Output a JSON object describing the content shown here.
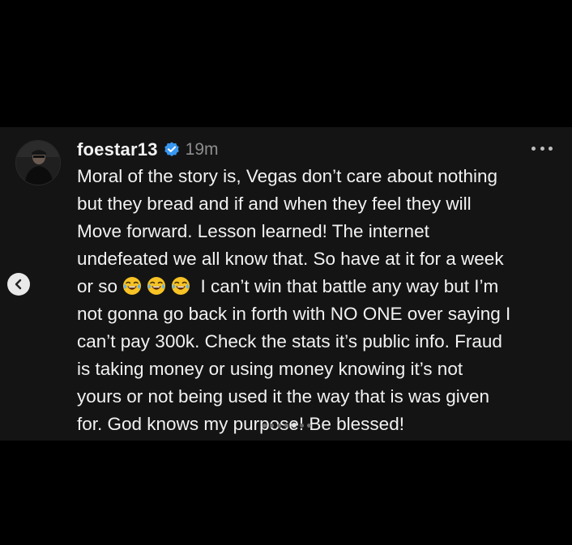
{
  "post": {
    "username": "foestar13",
    "timestamp": "19m",
    "verified": true,
    "lines": [
      "Moral of the story is, Vegas don’t care about nothing",
      "but they bread and if and when they feel they will",
      "Move forward. Lesson learned! The internet",
      "undefeated we all know that. So have at it for a week",
      "or so",
      " I can’t win that battle any way but I’m",
      "not gonna go back in forth with NO ONE over saying I",
      "can’t pay 300k. Check the stats it’s public info. Fraud",
      "is taking money or using money knowing it’s not",
      "yours or not being used it the way that is was given",
      "for. God knows my purpose! Be blessed!"
    ]
  },
  "icons": {
    "avatar": "profile-photo",
    "verified": "verified-badge-icon",
    "more": "more-options-icon",
    "emoji": "face-with-tears-of-joy-icon",
    "prev": "chevron-left-icon"
  },
  "colors": {
    "page_background": "#000000",
    "card_background": "#141414",
    "text_primary": "#f2f2f2",
    "text_secondary": "#8e8e8e",
    "verified_blue": "#3897f0"
  },
  "carousel": {
    "total": 7,
    "active": 4
  }
}
